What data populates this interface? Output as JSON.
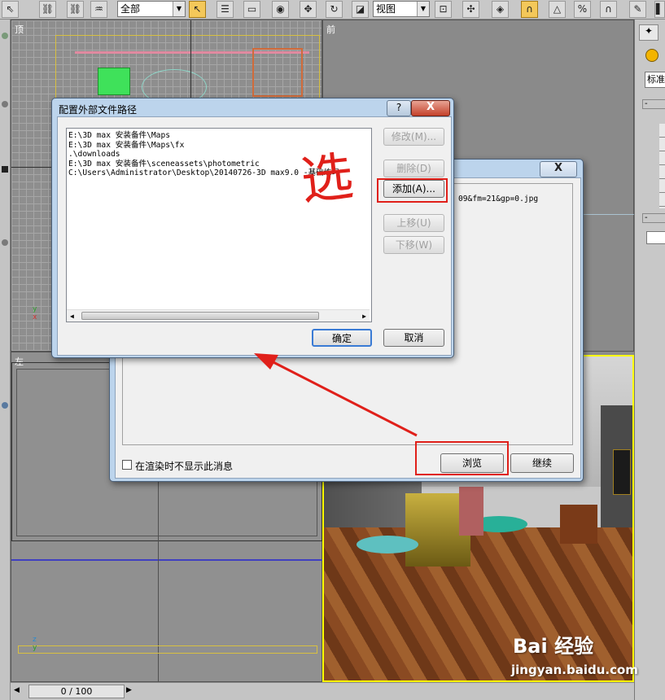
{
  "toolbar": {
    "selection_filter": "全部",
    "reference_coord": "视图"
  },
  "viewports": {
    "top": "顶",
    "front": "前",
    "left": "左"
  },
  "right_panel": {
    "standard_label": "标准",
    "rollout_minus": "-"
  },
  "time_slider": {
    "frame_label": "0 / 100"
  },
  "back_dialog": {
    "list_text": "09&fm=21&gp=0.jpg",
    "checkbox_label": "在渲染时不显示此消息",
    "browse_button": "浏览",
    "continue_button": "继续",
    "close_symbol": "X"
  },
  "front_dialog": {
    "title": "配置外部文件路径",
    "help_symbol": "?",
    "close_symbol": "X",
    "paths": [
      "E:\\3D max 安装备件\\Maps",
      "E:\\3D max 安装备件\\Maps\\fx",
      ".\\downloads",
      "E:\\3D max 安装备件\\sceneassets\\photometric",
      "C:\\Users\\Administrator\\Desktop\\20140726-3D max9.0 -基础练习"
    ],
    "buttons": {
      "modify": "修改(M)...",
      "delete": "删除(D)",
      "add": "添加(A)...",
      "move_up": "上移(U)",
      "move_down": "下移(W)",
      "ok": "确定",
      "cancel": "取消"
    }
  },
  "annotation": {
    "handwriting": "选"
  },
  "watermark": {
    "brand": "Bai 经验",
    "url": "jingyan.baidu.com"
  },
  "colors": {
    "annotation_red": "#e0201a",
    "selected_tool": "#f4c85a",
    "viewport_active": "#ffff00"
  }
}
